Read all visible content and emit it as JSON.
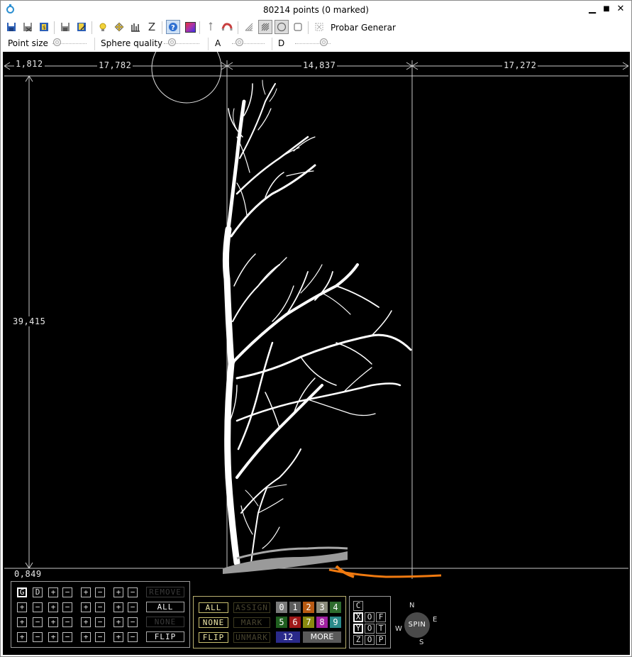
{
  "window": {
    "title": "80214 points (0 marked)",
    "minimize": "▁",
    "maximize": "■",
    "close": "✕"
  },
  "toolbar": {
    "icons": [
      "save-icon",
      "save-as-icon",
      "export-icon",
      "disk-icon",
      "disk-edit-icon",
      "light-bulb-icon",
      "move-icon",
      "histogram-icon",
      "z-axis-icon",
      "help-icon",
      "color-gradient-icon",
      "pointer-icon",
      "magnet-icon",
      "lasso-icon",
      "brush-icon",
      "circle-select-icon",
      "square-select-icon",
      "grid-icon"
    ],
    "z_label": "Z",
    "probar": "Probar",
    "generar": "Generar"
  },
  "sliders": {
    "point_size": "Point size",
    "sphere_quality": "Sphere quality",
    "a": "A",
    "d": "D"
  },
  "viewport": {
    "dim_left_top": "1,812",
    "dim_top_1": "17,782",
    "dim_top_2": "14,837",
    "dim_top_3": "17,272",
    "dim_height": "39,415",
    "dim_bottom": "0,849"
  },
  "groups": {
    "g": "G",
    "d": "D",
    "plus": "+",
    "minus": "−",
    "remove": "REMOVE",
    "all": "ALL",
    "none": "NONE",
    "flip": "FLIP"
  },
  "marks": {
    "all": "ALL",
    "assign": "ASSIGN",
    "none": "NONE",
    "mark": "MARK",
    "flip": "FLIP",
    "unmark": "UNMARK",
    "classes": [
      {
        "label": "0",
        "color": "#7a7a7a"
      },
      {
        "label": "1",
        "color": "#5c5c5c"
      },
      {
        "label": "2",
        "color": "#b85a12"
      },
      {
        "label": "3",
        "color": "#8a8a7a"
      },
      {
        "label": "4",
        "color": "#2e6b2e"
      },
      {
        "label": "5",
        "color": "#1f5f1f"
      },
      {
        "label": "6",
        "color": "#a01818"
      },
      {
        "label": "7",
        "color": "#8a8a10"
      },
      {
        "label": "8",
        "color": "#a020a0"
      },
      {
        "label": "9",
        "color": "#2a8a8a"
      },
      {
        "label": "12",
        "color": "#2a2a8a"
      }
    ],
    "more": "MORE"
  },
  "axes": {
    "c": "C",
    "x": "X",
    "o1": "O",
    "f": "F",
    "y": "Y",
    "o2": "O",
    "t": "T",
    "z": "Z",
    "o3": "O",
    "p": "P"
  },
  "compass": {
    "n": "N",
    "s": "S",
    "e": "E",
    "w": "W",
    "spin": "SPIN"
  },
  "colors": {
    "ground_orange": "#f07a10",
    "ground_gray": "#9a9a9a",
    "tree": "#ffffff",
    "accent": "#2b8fd1"
  }
}
